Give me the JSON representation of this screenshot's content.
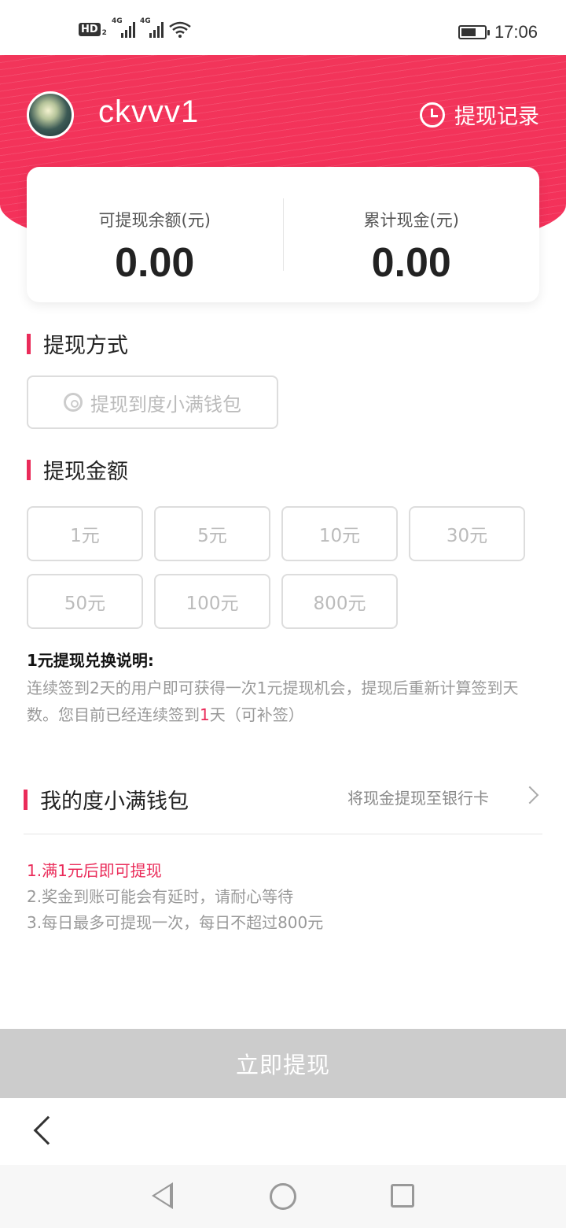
{
  "status_bar": {
    "hd_label": "HD",
    "hd_sub": "2",
    "network_1": "4G",
    "network_2": "4G",
    "time": "17:06",
    "icons": [
      "signal-icon",
      "wifi-icon",
      "battery-icon"
    ]
  },
  "header": {
    "username": "ckvvv1",
    "history_label": "提现记录"
  },
  "balance_card": {
    "withdrawable_label": "可提现余额(元)",
    "withdrawable_value": "0.00",
    "total_label": "累计现金(元)",
    "total_value": "0.00"
  },
  "method_section": {
    "title": "提现方式",
    "option_label": "提现到度小满钱包"
  },
  "amount_section": {
    "title": "提现金额",
    "options": [
      "1元",
      "5元",
      "10元",
      "30元",
      "50元",
      "100元",
      "800元"
    ]
  },
  "note": {
    "title": "1元提现兑换说明:",
    "body_prefix": "连续签到2天的用户即可获得一次1元提现机会，提现后重新计算签到天数。您目前已经连续签到",
    "days": "1",
    "body_suffix": "天（可补签）"
  },
  "wallet": {
    "title": "我的度小满钱包",
    "hint": "将现金提现至银行卡"
  },
  "rules": [
    "1.满1元后即可提现",
    "2.奖金到账可能会有延时，请耐心等待",
    "3.每日最多可提现一次，每日不超过800元"
  ],
  "submit_label": "立即提现",
  "colors": {
    "accent": "#ea2c5a",
    "header_bg": "#f2355a",
    "disabled_button": "#cccccc"
  }
}
